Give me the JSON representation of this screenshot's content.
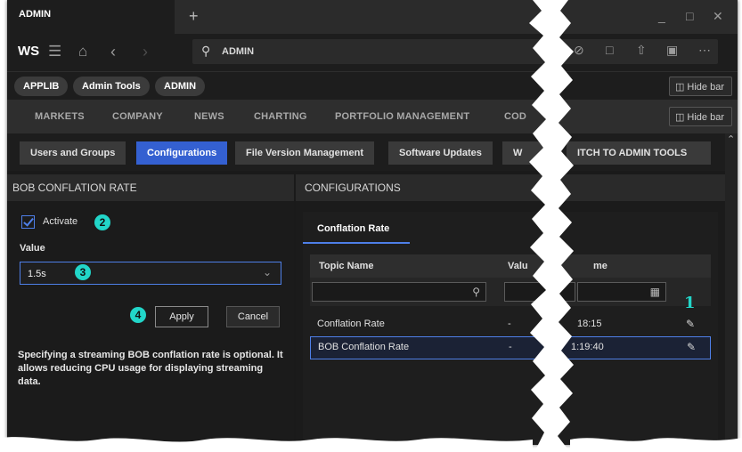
{
  "window": {
    "tab_title": "ADMIN",
    "new_tab_icon": "plus-icon",
    "controls": [
      "minimize-icon",
      "maximize-icon",
      "close-icon"
    ]
  },
  "toolbar": {
    "logo": "WS",
    "search_value": "ADMIN",
    "icons": [
      "menu-icon",
      "home-icon",
      "back-icon",
      "forward-icon",
      "search-icon",
      "link-icon",
      "new-window-icon",
      "share-icon",
      "save-icon",
      "more-icon"
    ]
  },
  "chips": {
    "items": [
      "APPLIB",
      "Admin Tools",
      "ADMIN"
    ],
    "hide_bar": "Hide bar"
  },
  "menu": {
    "items": [
      "MARKETS",
      "COMPANY",
      "NEWS",
      "CHARTING",
      "PORTFOLIO MANAGEMENT",
      "COD"
    ],
    "hide_bar": "Hide bar"
  },
  "subtabs": {
    "items": [
      "Users and Groups",
      "Configurations",
      "File Version Management",
      "Software Updates",
      "W",
      "ITCH TO ADMIN TOOLS"
    ],
    "active": "Configurations"
  },
  "left_panel": {
    "title": "BOB CONFLATION RATE",
    "activate_label": "Activate",
    "activate_checked": true,
    "value_label": "Value",
    "value_selected": "1.5s",
    "apply_label": "Apply",
    "cancel_label": "Cancel",
    "description": "Specifying a streaming BOB conflation rate is optional. It allows reducing CPU usage for displaying streaming data.",
    "callouts": [
      "2",
      "3",
      "4"
    ]
  },
  "right_panel": {
    "title": "CONFIGURATIONS",
    "tab": "Conflation Rate",
    "columns": [
      "Topic Name",
      "Valu",
      "me"
    ],
    "rows": [
      {
        "topic": "Conflation Rate",
        "value": "-",
        "time": "18:15"
      },
      {
        "topic": "BOB Conflation Rate",
        "value": "-",
        "time": "1:19:40"
      }
    ],
    "callout": "1"
  },
  "colors": {
    "accent": "#3460d1",
    "highlight": "#4e7fe8",
    "callout": "#22d6c9",
    "background": "#1b1b1b"
  }
}
